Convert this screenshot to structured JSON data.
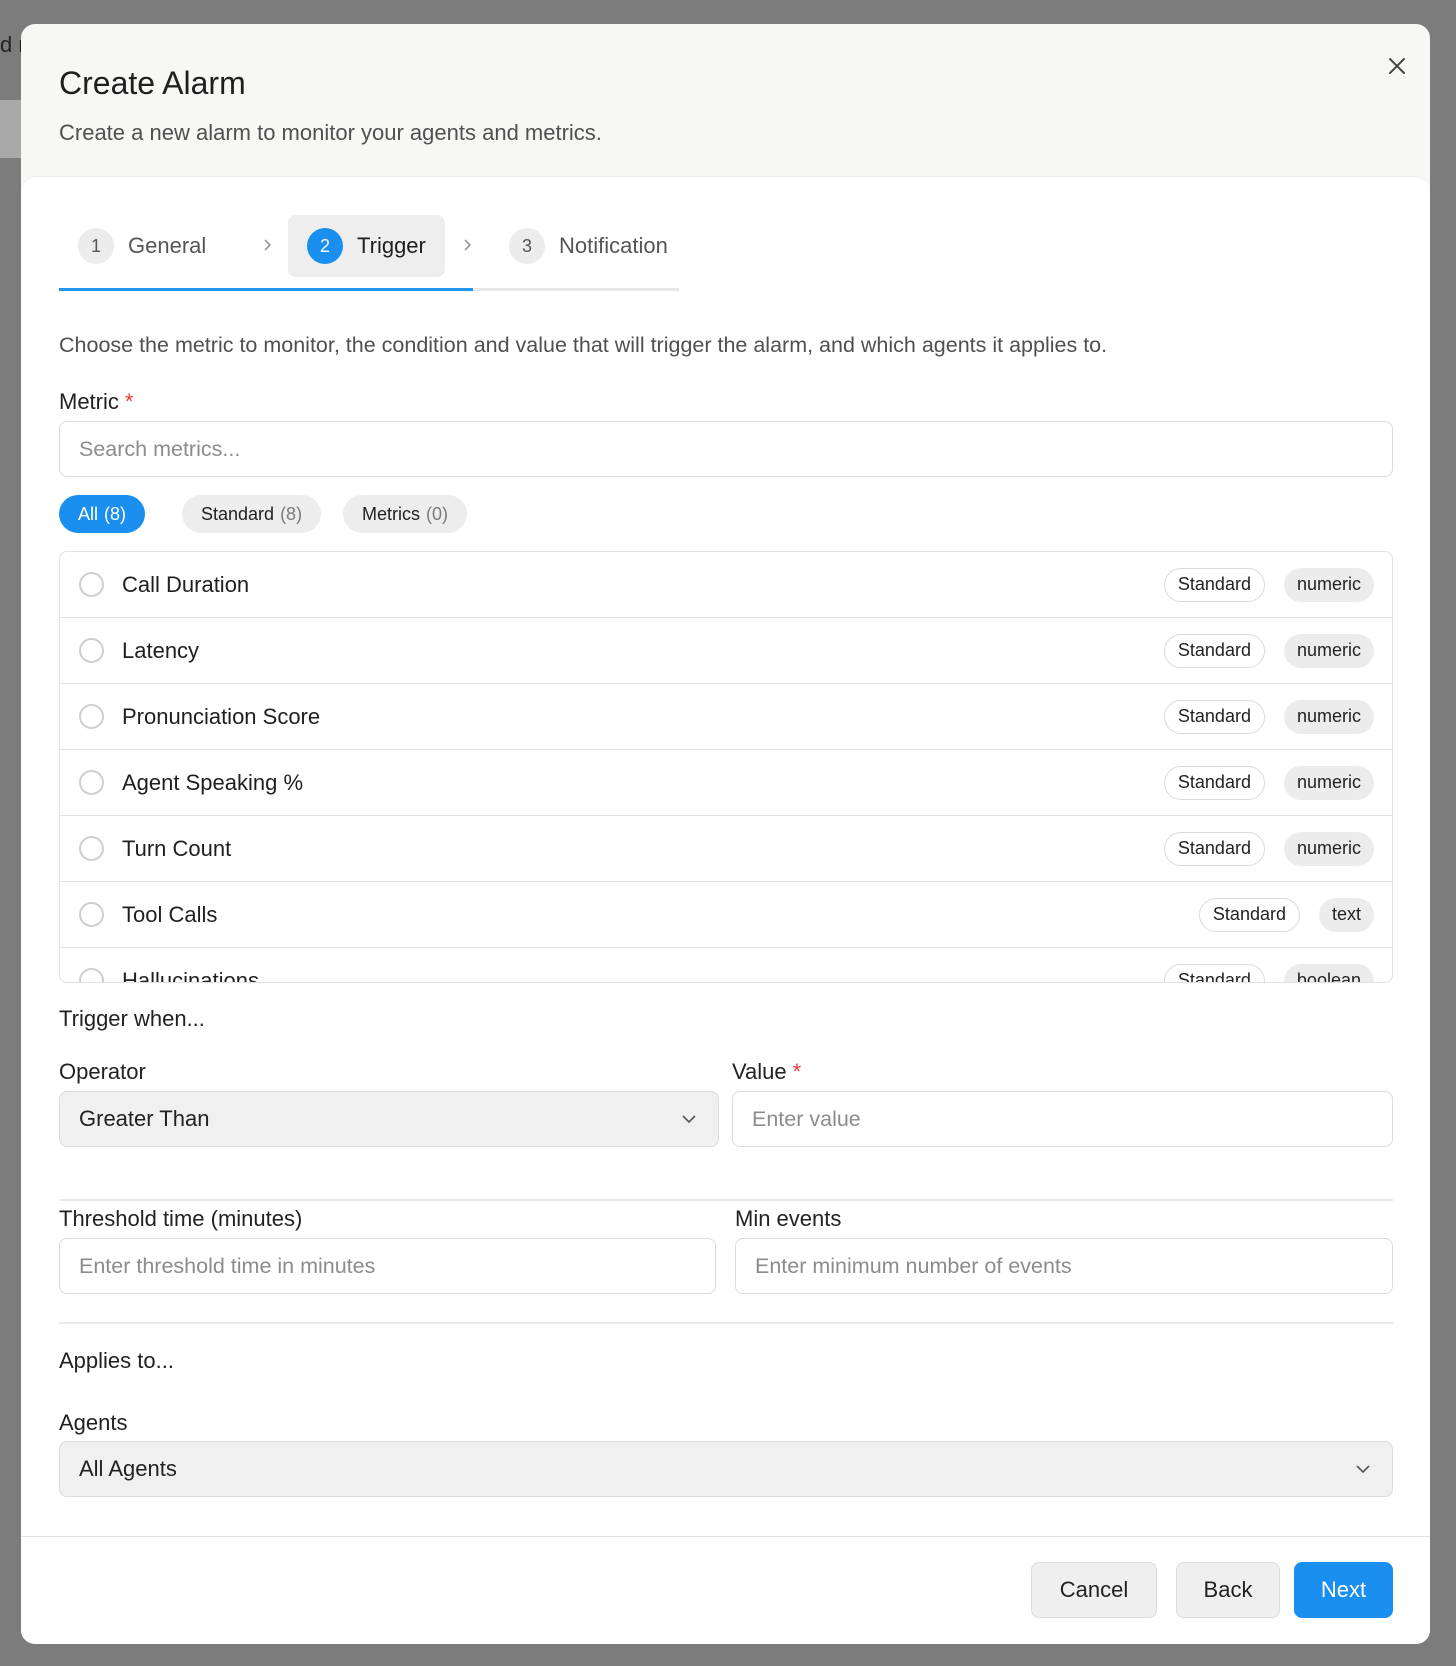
{
  "background": {
    "peek_text": "d r"
  },
  "dialog": {
    "title": "Create Alarm",
    "subtitle": "Create a new alarm to monitor your agents and metrics.",
    "close_icon": "close-icon"
  },
  "steps": [
    {
      "number": "1",
      "label": "General",
      "active": false
    },
    {
      "number": "2",
      "label": "Trigger",
      "active": true
    },
    {
      "number": "3",
      "label": "Notification",
      "active": false
    }
  ],
  "description": "Choose the metric to monitor, the condition and value that will trigger the alarm, and which agents it applies to.",
  "metric": {
    "label": "Metric",
    "required_mark": "*",
    "search_placeholder": "Search metrics...",
    "filters": [
      {
        "label": "All",
        "count": "(8)",
        "active": true
      },
      {
        "label": "Standard",
        "count": "(8)",
        "active": false
      },
      {
        "label": "Metrics",
        "count": "(0)",
        "active": false
      }
    ],
    "items": [
      {
        "label": "Call Duration",
        "source": "Standard",
        "type": "numeric"
      },
      {
        "label": "Latency",
        "source": "Standard",
        "type": "numeric"
      },
      {
        "label": "Pronunciation Score",
        "source": "Standard",
        "type": "numeric"
      },
      {
        "label": "Agent Speaking %",
        "source": "Standard",
        "type": "numeric"
      },
      {
        "label": "Turn Count",
        "source": "Standard",
        "type": "numeric"
      },
      {
        "label": "Tool Calls",
        "source": "Standard",
        "type": "text"
      },
      {
        "label": "Hallucinations",
        "source": "Standard",
        "type": "boolean"
      }
    ]
  },
  "trigger": {
    "heading": "Trigger when...",
    "operator_label": "Operator",
    "operator_value": "Greater Than",
    "value_label": "Value",
    "value_required_mark": "*",
    "value_placeholder": "Enter value",
    "threshold_label": "Threshold time (minutes)",
    "threshold_placeholder": "Enter threshold time in minutes",
    "min_events_label": "Min events",
    "min_events_placeholder": "Enter minimum number of events"
  },
  "applies": {
    "heading": "Applies to...",
    "agents_label": "Agents",
    "agents_value": "All Agents"
  },
  "footer": {
    "cancel_label": "Cancel",
    "back_label": "Back",
    "next_label": "Next"
  },
  "colors": {
    "accent": "#1a8ff0",
    "required": "#e53935",
    "overlay": "#7c7c7c"
  }
}
